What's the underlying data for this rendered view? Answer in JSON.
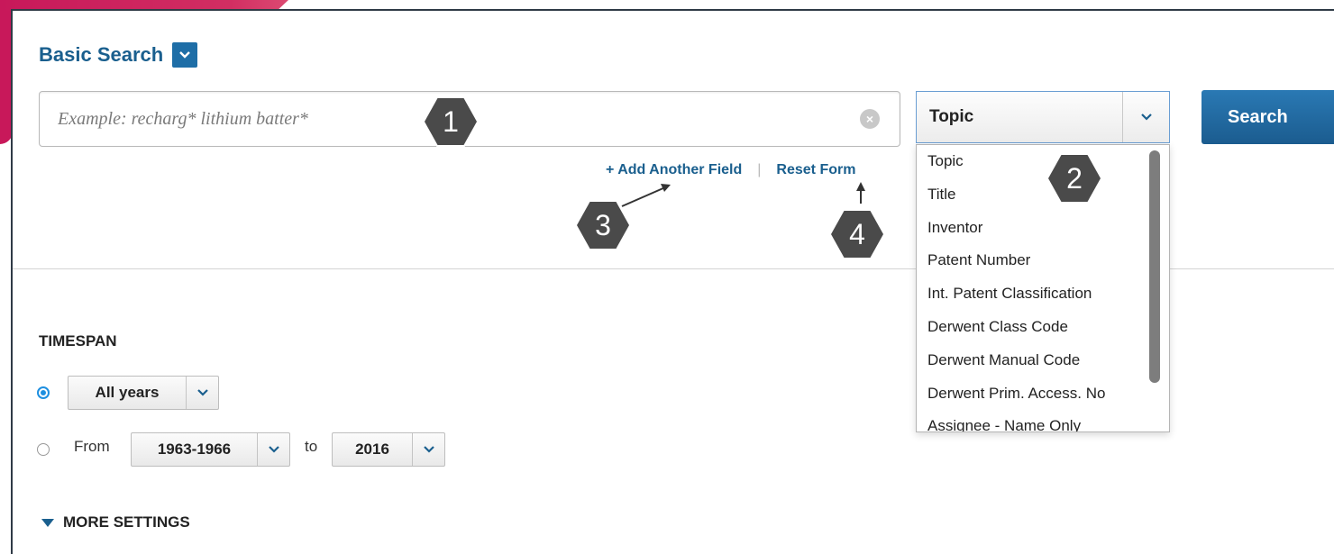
{
  "header": {
    "title": "Basic Search"
  },
  "search": {
    "placeholder": "Example: recharg* lithium batter*",
    "field_selected": "Topic",
    "button_label": "Search"
  },
  "links": {
    "add_field": "+ Add Another Field",
    "separator": "|",
    "reset": "Reset Form"
  },
  "field_options": [
    "Topic",
    "Title",
    "Inventor",
    "Patent Number",
    "Int. Patent Classification",
    "Derwent Class Code",
    "Derwent Manual Code",
    "Derwent Prim. Access. No",
    "Assignee - Name Only"
  ],
  "timespan": {
    "label": "TIMESPAN",
    "preset": "All years",
    "from_label": "From",
    "from_value": "1963-1966",
    "to_label": "to",
    "to_value": "2016"
  },
  "more_settings": "MORE SETTINGS",
  "markers": [
    "1",
    "2",
    "3",
    "4"
  ],
  "colors": {
    "accent": "#1a5f8e",
    "button": "#1e6ea7",
    "brand": "#c8185a"
  }
}
